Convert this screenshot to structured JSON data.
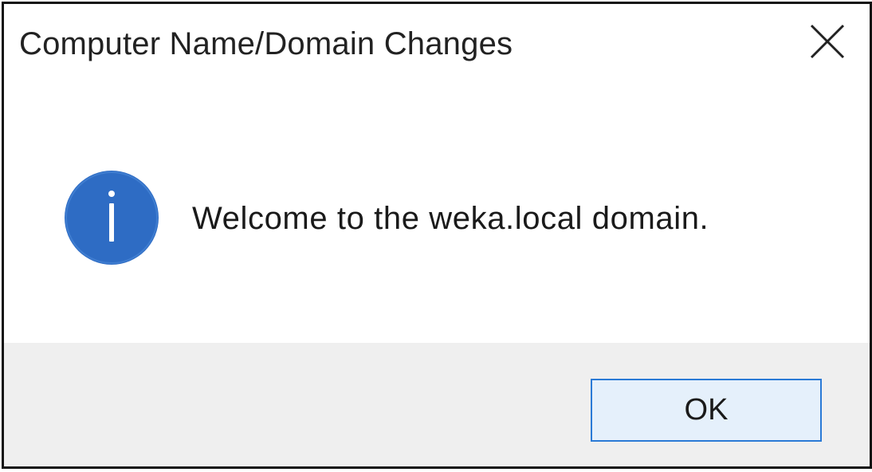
{
  "window": {
    "title": "Computer Name/Domain Changes",
    "close_icon": "close-icon"
  },
  "content": {
    "icon": "info-icon",
    "message": "Welcome to the weka.local domain."
  },
  "footer": {
    "ok_label": "OK"
  },
  "colors": {
    "info_icon": "#2e6cc4",
    "button_border": "#2a7ad6",
    "button_fill": "#e5f0fb",
    "footer_bg": "#efefef"
  }
}
